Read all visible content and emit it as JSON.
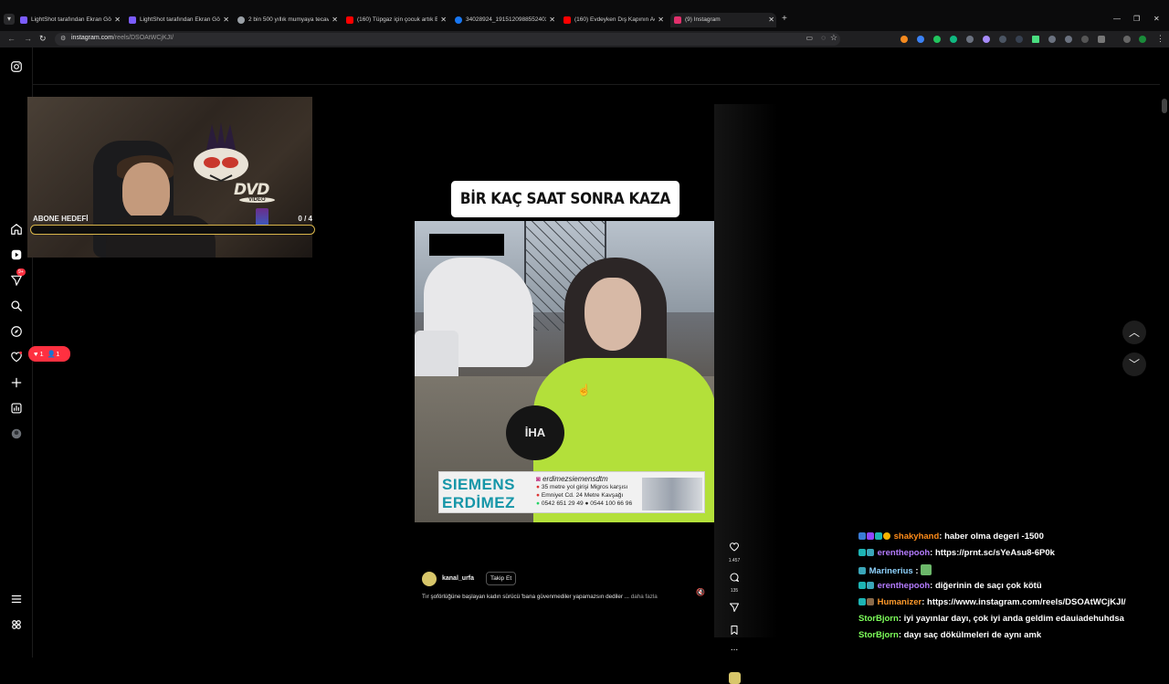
{
  "browser": {
    "tabs": [
      {
        "title": "LightShot tarafından Ekran Gör",
        "color": "#7b5cff"
      },
      {
        "title": "LightShot tarafından Ekran Gör",
        "color": "#7b5cff"
      },
      {
        "title": "2 bin 500 yıllık mumyaya tecav",
        "color": "#9aa0a6"
      },
      {
        "title": "(160) Tüpgaz için çocuk artık B",
        "color": "#ff0000"
      },
      {
        "title": "34028924_1915120988552403",
        "color": "#1877f2"
      },
      {
        "title": "(160) Evdeyken Dış Kapının Aç",
        "color": "#ff0000"
      },
      {
        "title": "(9) Instagram",
        "color": "#e1306c",
        "active": true
      }
    ],
    "new_tab": "+",
    "url_domain": "instagram.com",
    "url_path": "/reels/DSOAtWCjKJI/"
  },
  "stream_overlay": {
    "goal_label": "ABONE HEDEFİ",
    "goal_count": "0 / 4",
    "goal_progress": 0,
    "webcam_logo": "DVD",
    "webcam_logo_sub": "VIDEO"
  },
  "sidebar": {
    "notifications_badge": "9+",
    "activity_likes": "1",
    "activity_follows": "1"
  },
  "reel": {
    "caption_overlay": "BİR KAÇ SAAT SONRA KAZA YAPTI",
    "mic_logo": "İHA",
    "ad": {
      "brand_line1": "SIEMENS",
      "brand_line2": "ERDİMEZ",
      "handle": "erdimezsiemensdtm",
      "line1": "35 metre yol girişi Migros karşısı",
      "line2": "Emniyet Cd. 24 Metre Kavşağı",
      "phones": "0542 651 29 49 ● 0544 100 66 96"
    },
    "author": "kanal_urfa",
    "follow_label": "Takip Et",
    "description": "Tır şoförlüğüne başlayan kadın sürücü 'bana güvenmediler yapamazsın dediler ...",
    "more_label": "daha fazla",
    "like_count": "1.457",
    "comment_count": "135",
    "more_actions": "..."
  },
  "chat": [
    {
      "user": "shakyhand",
      "color": "#ff8c1a",
      "text": ": haber olma degeri -1500"
    },
    {
      "user": "erenthepooh",
      "color": "#b57cff",
      "text": ": https://prnt.sc/sYeAsu8-6P0k"
    },
    {
      "user": "Marinerius",
      "color": "#8fd3ff",
      "text": " :"
    },
    {
      "user": "erenthepooh",
      "color": "#b57cff",
      "text": ": diğerinin de saçı çok kötü"
    },
    {
      "user": "Humanizer",
      "color": "#ff9a2b",
      "text": ": https://www.instagram.com/reels/DSOAtWCjKJI/"
    },
    {
      "user": "StorBjorn",
      "color": "#7dff5a",
      "text": ": iyi yayınlar dayı, çok iyi anda geldim edauiadehuhdsa"
    },
    {
      "user": "StorBjorn",
      "color": "#7dff5a",
      "text": ": dayı saç dökülmeleri de aynı amk"
    }
  ]
}
